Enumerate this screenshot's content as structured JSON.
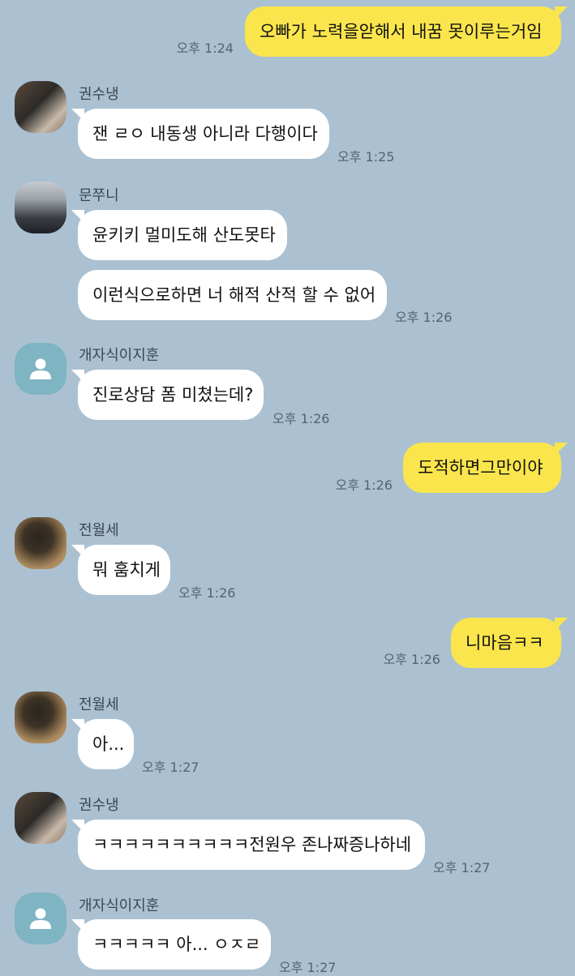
{
  "messages": [
    {
      "sender": "me",
      "text": "오빠가 노력을앋해서 내꿈 못이루는거임",
      "time": "오후 1:24"
    },
    {
      "sender": "권수냉",
      "avatar": "profile-photo",
      "text": "잰 ㄹㅇ 내동생 아니라 다행이다",
      "time": "오후 1:25"
    },
    {
      "sender": "문쭈니",
      "avatar": "profile-photo",
      "text": "윤키키 멀미도해 산도못타"
    },
    {
      "sender": "문쭈니",
      "text": "이런식으로하면 너 해적 산적 할 수 없어",
      "time": "오후 1:26"
    },
    {
      "sender": "개자식이지훈",
      "avatar": "default-person-icon",
      "text": "진로상담 폼 미쳤는데?",
      "time": "오후 1:26"
    },
    {
      "sender": "me",
      "text": "도적하면그만이야",
      "time": "오후 1:26"
    },
    {
      "sender": "전월세",
      "avatar": "profile-photo",
      "text": "뭐 훔치게",
      "time": "오후 1:26"
    },
    {
      "sender": "me",
      "text": "니마음ㅋㅋ",
      "time": "오후 1:26"
    },
    {
      "sender": "전월세",
      "avatar": "profile-photo",
      "text": "아...",
      "time": "오후 1:27"
    },
    {
      "sender": "권수냉",
      "avatar": "profile-photo",
      "text": "ㅋㅋㅋㅋㅋㅋㅋㅋㅋㅋ전원우 존나짜증나하네",
      "time": "오후 1:27"
    },
    {
      "sender": "개자식이지훈",
      "avatar": "default-person-icon",
      "text": "ㅋㅋㅋㅋㅋ 아... ㅇㅈㄹ",
      "time": "오후 1:27"
    }
  ],
  "colors": {
    "background": "#abc1d1",
    "my_bubble": "#fae64c",
    "other_bubble": "#ffffff"
  }
}
